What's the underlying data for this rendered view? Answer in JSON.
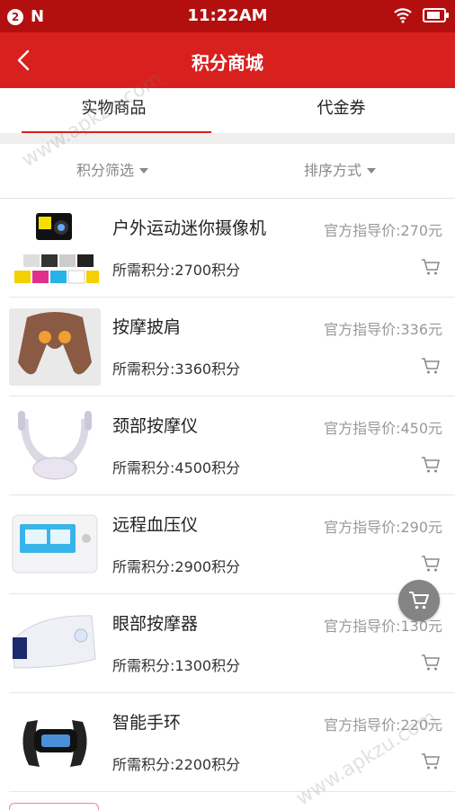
{
  "status": {
    "badge": "2",
    "carrier": "N",
    "time": "11:22AM"
  },
  "header": {
    "title": "积分商城"
  },
  "tabs": [
    {
      "label": "实物商品"
    },
    {
      "label": "代金券"
    }
  ],
  "filters": {
    "points_filter": "积分筛选",
    "sort": "排序方式"
  },
  "watermark": "www.apkzu.com",
  "products": [
    {
      "name": "户外运动迷你摄像机",
      "price": "官方指导价:270元",
      "points": "所需积分:2700积分",
      "image": "camera"
    },
    {
      "name": "按摩披肩",
      "price": "官方指导价:336元",
      "points": "所需积分:3360积分",
      "image": "massage-shawl"
    },
    {
      "name": "颈部按摩仪",
      "price": "官方指导价:450元",
      "points": "所需积分:4500积分",
      "image": "neck-massager"
    },
    {
      "name": "远程血压仪",
      "price": "官方指导价:290元",
      "points": "所需积分:2900积分",
      "image": "blood-pressure-monitor"
    },
    {
      "name": "眼部按摩器",
      "price": "官方指导价:130元",
      "points": "所需积分:1300积分",
      "image": "eye-massager"
    },
    {
      "name": "智能手环",
      "price": "官方指导价:220元",
      "points": "所需积分:2200积分",
      "image": "smart-band"
    }
  ],
  "colors": {
    "brand_red": "#d8201f",
    "status_red": "#b30f0f"
  },
  "icons": {
    "back": "chevron-left-icon",
    "cart": "cart-icon",
    "floating_cart": "cart-icon"
  }
}
